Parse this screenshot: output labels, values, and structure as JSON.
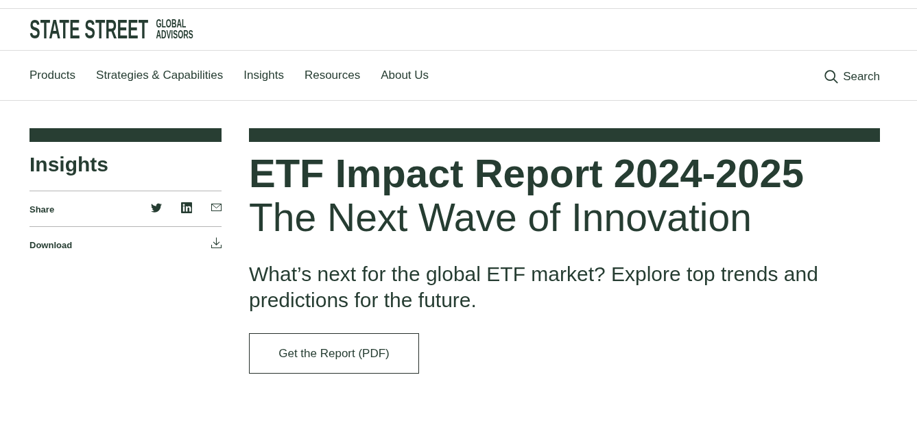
{
  "header": {
    "logo": {
      "wordmark": "STATE STREET",
      "tagline": "GLOBAL ADVISORS"
    }
  },
  "nav": {
    "items": [
      {
        "label": "Products"
      },
      {
        "label": "Strategies & Capabilities"
      },
      {
        "label": "Insights"
      },
      {
        "label": "Resources"
      },
      {
        "label": "About Us"
      }
    ],
    "search": {
      "label": "Search"
    }
  },
  "sidebar": {
    "title": "Insights",
    "share": {
      "label": "Share"
    },
    "download": {
      "label": "Download"
    }
  },
  "main": {
    "title": "ETF Impact Report 2024-2025",
    "subtitle": "The Next Wave of Innovation",
    "description": "What’s next for the global ETF market? Explore top trends and predictions for the future.",
    "button": {
      "label": "Get the Report (PDF)"
    }
  }
}
